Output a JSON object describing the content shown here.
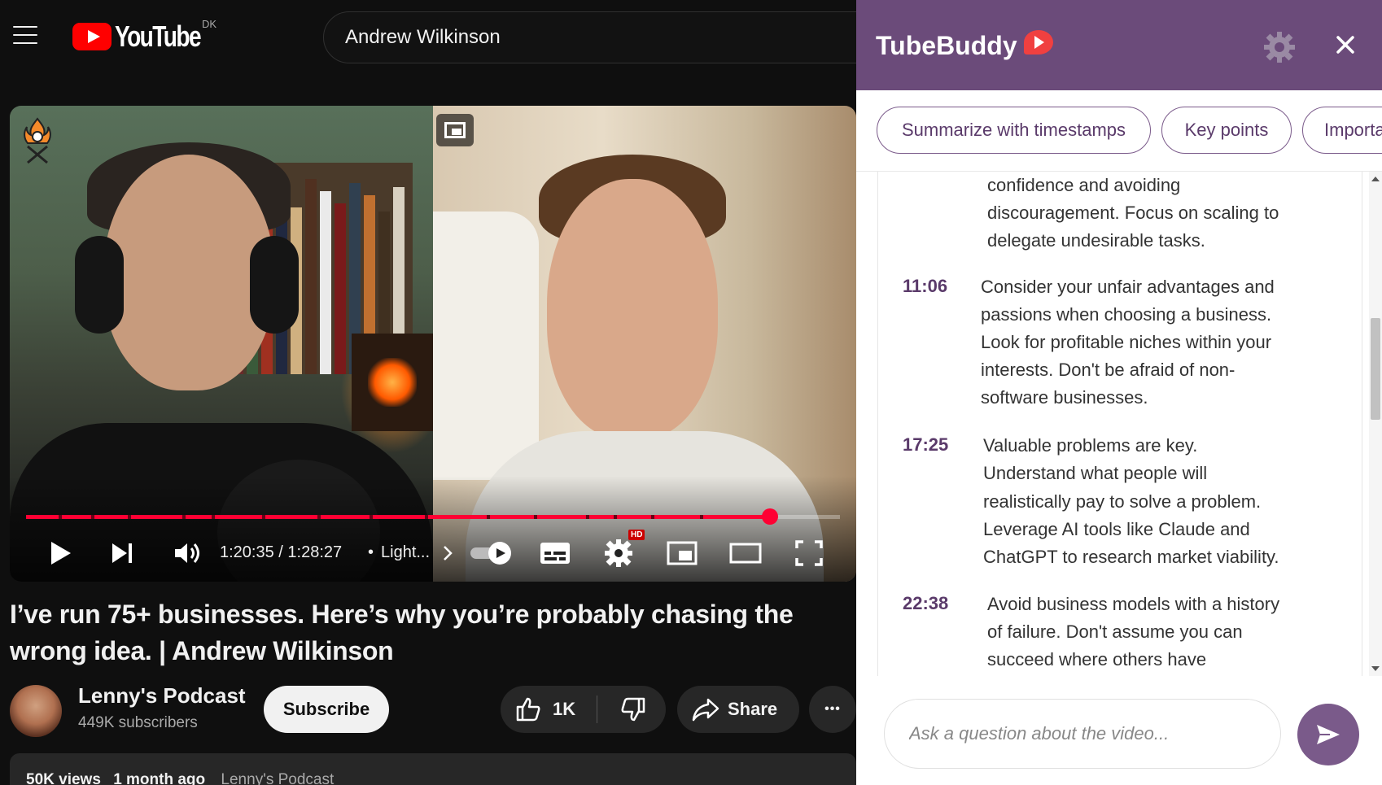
{
  "youtube": {
    "logo_text": "YouTube",
    "country_code": "DK",
    "search_value": "Andrew Wilkinson"
  },
  "player": {
    "time_display": "1:20:35 / 1:28:27",
    "separator": "•",
    "chapter_label": "Light...",
    "progress_fraction": 0.914,
    "hd_badge": "HD",
    "accent_color": "#ff0033"
  },
  "video": {
    "title": "I’ve run 75+ businesses. Here’s why you’re probably chasing the wrong idea. | Andrew Wilkinson",
    "channel_name": "Lenny's Podcast",
    "subscribers": "449K subscribers",
    "subscribe_label": "Subscribe",
    "like_count": "1K",
    "share_label": "Share",
    "more_label": "•••",
    "views": "50K views",
    "age": "1 month ago",
    "desc_channel": "Lenny's Podcast"
  },
  "tubebuddy": {
    "brand": "TubeBuddy",
    "header_color": "#6b4b7a",
    "chips": [
      "Summarize with timestamps",
      "Key points",
      "Importa"
    ],
    "partial_lines": [
      "confidence and avoiding",
      "discouragement. Focus on scaling to",
      "delegate undesirable tasks."
    ],
    "entries": [
      {
        "timestamp": "11:06",
        "lines": [
          "Consider your unfair advantages and",
          "passions when choosing a business.",
          "Look for profitable niches within your",
          "interests. Don't be afraid of non-",
          "software businesses."
        ]
      },
      {
        "timestamp": "17:25",
        "lines": [
          "Valuable problems are key.",
          "Understand what people will",
          "realistically pay to solve a problem.",
          "Leverage AI tools like Claude and",
          "ChatGPT to research market viability."
        ]
      },
      {
        "timestamp": "22:38",
        "lines": [
          "Avoid business models with a history",
          "of failure. Don't assume you can",
          "succeed where others have"
        ]
      }
    ],
    "ask_placeholder": "Ask a question about the video..."
  }
}
